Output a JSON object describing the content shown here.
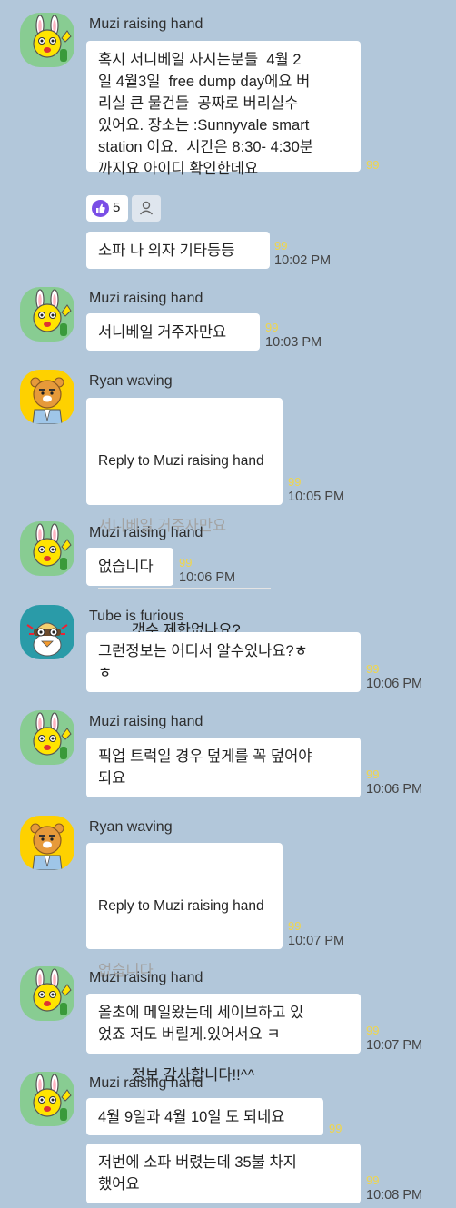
{
  "chat": {
    "messages": [
      {
        "sender": "Muzi raising hand",
        "text": "혹시 서니베일 사시는분들  4월 2\n일 4월3일  free dump day에요 버\n리실 큰 물건들  공짜로 버리실수\n있어요. 장소는 :Sunnyvale smart\nstation 이요.  시간은 8:30- 4:30분\n까지요 아이디 확인한데요",
        "count": "99",
        "time": ""
      },
      {
        "text": "소파 나 의자 기타등등",
        "count": "99",
        "time": "10:02 PM"
      },
      {
        "sender": "Muzi raising hand",
        "text": "서니베일 거주자만요",
        "count": "99",
        "time": "10:03 PM"
      },
      {
        "sender": "Ryan waving",
        "reply_to": "Reply to Muzi raising hand",
        "quote": "서니베일 거주자만요",
        "text": "갯수 제한없나요?",
        "count": "99",
        "time": "10:05 PM"
      },
      {
        "sender": "Muzi raising hand",
        "text": "없습니다",
        "count": "99",
        "time": "10:06 PM"
      },
      {
        "sender": "Tube is furious",
        "text": "그런정보는 어디서 알수있나요?ㅎ\nㅎ",
        "count": "99",
        "time": "10:06 PM"
      },
      {
        "sender": "Muzi raising hand",
        "text": "픽업 트럭일 경우 덮게를 꼭 덮어야\n되요",
        "count": "99",
        "time": "10:06 PM"
      },
      {
        "sender": "Ryan waving",
        "reply_to": "Reply to Muzi raising hand",
        "quote": "없습니다",
        "text": "정보 감사합니다!!^^",
        "count": "99",
        "time": "10:07 PM"
      },
      {
        "sender": "Muzi raising hand",
        "text": "올초에 메일왔는데 세이브하고 있\n었죠 저도 버릴게.있어서요 ㅋ",
        "count": "99",
        "time": "10:07 PM"
      },
      {
        "sender": "Muzi raising hand",
        "text": "4월 9일과 4월 10일 도 되네요",
        "count": "99",
        "time": ""
      },
      {
        "text": "저번에 소파 버렸는데 35불 차지\n했어요",
        "count": "99",
        "time": "10:08 PM"
      }
    ],
    "reactions": {
      "like_count": "5",
      "like_icon": "thumbs-up-icon",
      "add_icon": "person-outline-icon"
    }
  },
  "colors": {
    "background": "#b2c7da",
    "bubble": "#ffffff",
    "unread_count": "#f0d64b",
    "reaction_like": "#7a4ee6",
    "muzi_avatar": "#88cc92",
    "ryan_avatar": "#fed100",
    "tube_avatar": "#2a9ba8"
  }
}
